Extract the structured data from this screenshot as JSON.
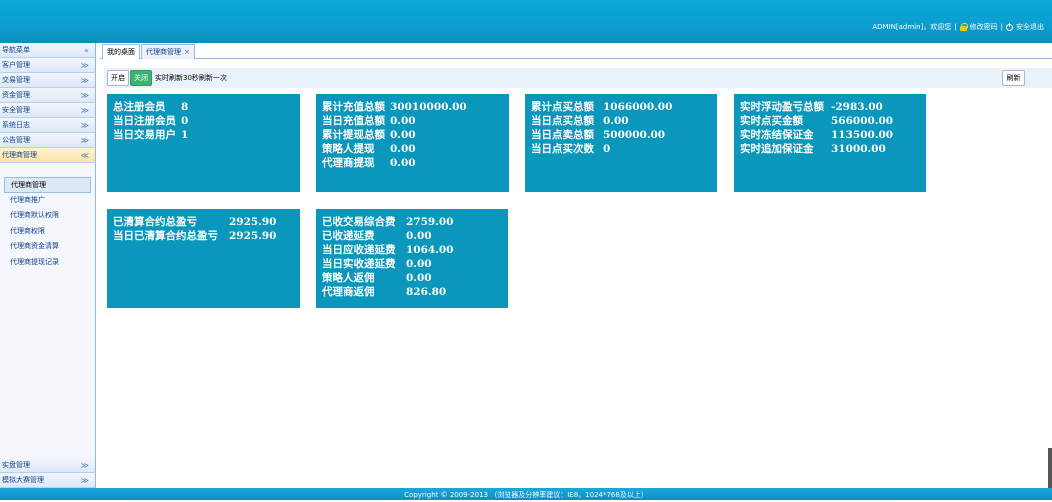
{
  "header": {
    "user": "ADMIN[admin]，欢迎您",
    "sep": "|",
    "change_password": "修改密码",
    "logout": "安全退出"
  },
  "sidebar": {
    "title": "导航菜单",
    "groups": [
      {
        "label": "客户管理"
      },
      {
        "label": "交易管理"
      },
      {
        "label": "资金管理"
      },
      {
        "label": "安全管理"
      },
      {
        "label": "系统日志"
      },
      {
        "label": "公告管理"
      },
      {
        "label": "代理商管理"
      }
    ],
    "sub_items": [
      {
        "label": "代理商管理"
      },
      {
        "label": "代理商推广"
      },
      {
        "label": "代理商默认权限"
      },
      {
        "label": "代理商权限"
      },
      {
        "label": "代理商资金清算"
      },
      {
        "label": "代理商提现记录"
      }
    ],
    "bottom_groups": [
      {
        "label": "实盘管理"
      },
      {
        "label": "模拟大赛管理"
      }
    ]
  },
  "tabs": [
    {
      "label": "我的桌面"
    },
    {
      "label": "代理商管理"
    }
  ],
  "toolbar": {
    "on_label": "开启",
    "off_label": "关闭",
    "refresh_hint": "实时刷新30秒刷新一次",
    "refresh_label": "刷新"
  },
  "cards": [
    {
      "rows": [
        {
          "label": "总注册会员",
          "value": "8"
        },
        {
          "label": "当日注册会员",
          "value": "0"
        },
        {
          "label": "当日交易用户",
          "value": "1"
        }
      ]
    },
    {
      "rows": [
        {
          "label": "累计充值总额",
          "value": "30010000.00"
        },
        {
          "label": "当日充值总额",
          "value": "0.00"
        },
        {
          "label": "累计提现总额",
          "value": "0.00"
        },
        {
          "label": "策略人提现",
          "value": "0.00"
        },
        {
          "label": "代理商提现",
          "value": "0.00"
        }
      ]
    },
    {
      "rows": [
        {
          "label": "累计点买总额",
          "value": "1066000.00"
        },
        {
          "label": "当日点买总额",
          "value": "0.00"
        },
        {
          "label": "当日点卖总额",
          "value": "500000.00"
        },
        {
          "label": "当日点买次数",
          "value": "0"
        }
      ]
    },
    {
      "rows": [
        {
          "label": "实时浮动盈亏总额",
          "value": "-2983.00"
        },
        {
          "label": "实时点买金额",
          "value": "566000.00"
        },
        {
          "label": "实时冻结保证金",
          "value": "113500.00"
        },
        {
          "label": "实时追加保证金",
          "value": "31000.00"
        }
      ]
    },
    {
      "rows": [
        {
          "label": "已清算合约总盈亏",
          "value": "2925.90"
        },
        {
          "label": "当日已清算合约总盈亏",
          "value": "2925.90"
        }
      ]
    },
    {
      "rows": [
        {
          "label": "已收交易综合费",
          "value": "2759.00"
        },
        {
          "label": "已收递延费",
          "value": "0.00"
        },
        {
          "label": "当日应收递延费",
          "value": "1064.00"
        },
        {
          "label": "当日实收递延费",
          "value": "0.00"
        },
        {
          "label": "策略人返佣",
          "value": "0.00"
        },
        {
          "label": "代理商返佣",
          "value": "826.80"
        }
      ]
    }
  ],
  "footer": {
    "text": "Copyright © 2009-2013 （浏览器及分辨率建议：IE8，1024*768及以上）"
  },
  "colors": {
    "header_blue": "#0b9fd0",
    "card_blue": "#0b96bb",
    "off_button_green": "#3cb371"
  }
}
